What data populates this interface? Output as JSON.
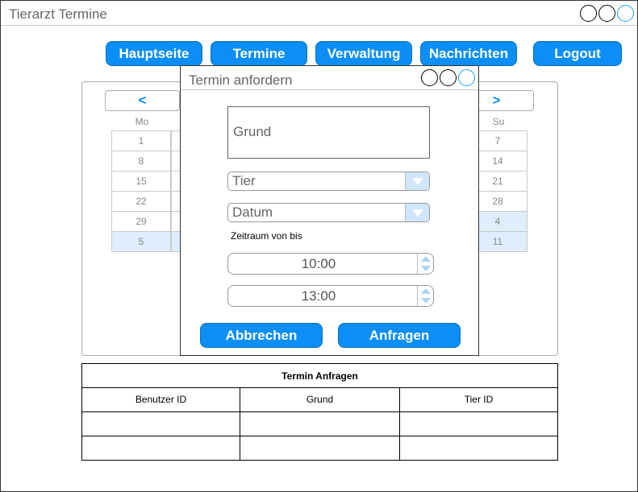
{
  "window": {
    "title": "Tierarzt Termine"
  },
  "nav": {
    "home": "Hauptseite",
    "appointments": "Termine",
    "management": "Verwaltung",
    "messages": "Nachrichten",
    "logout": "Logout"
  },
  "calendar": {
    "prev": "<",
    "next": ">",
    "day_mo": "Mo",
    "day_su": "Su",
    "mo_dates": [
      "1",
      "8",
      "15",
      "22",
      "29",
      "5"
    ],
    "su_dates": [
      "7",
      "14",
      "21",
      "28",
      "4",
      "11"
    ]
  },
  "requests_table": {
    "title": "Termin Anfragen",
    "columns": [
      "Benutzer ID",
      "Grund",
      "Tier ID"
    ]
  },
  "dialog": {
    "title": "Termin anfordern",
    "reason_placeholder": "Grund",
    "animal": "Tier",
    "date": "Datum",
    "range_label": "Zeitraum von bis",
    "time_from": "10:00",
    "time_to": "13:00",
    "cancel": "Abbrechen",
    "request": "Anfragen"
  }
}
